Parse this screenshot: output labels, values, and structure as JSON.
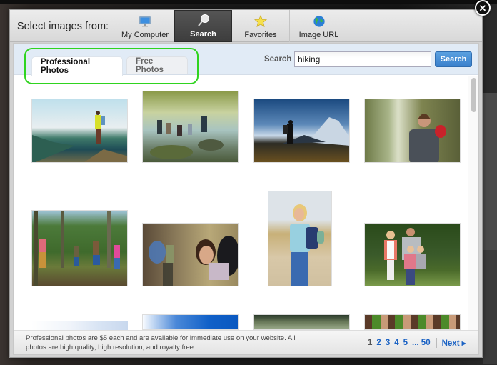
{
  "dialog": {
    "source_label": "Select images from:",
    "sources": [
      {
        "label": "My Computer",
        "icon": "monitor-icon",
        "active": false
      },
      {
        "label": "Search",
        "icon": "magnifier-icon",
        "active": true
      },
      {
        "label": "Favorites",
        "icon": "star-icon",
        "active": false
      },
      {
        "label": "Image URL",
        "icon": "globe-icon",
        "active": false
      }
    ],
    "close_icon": "close-icon"
  },
  "tabs": {
    "professional": "Professional Photos",
    "free": "Free Photos",
    "active": "Professional Photos"
  },
  "search": {
    "label": "Search",
    "value": "hiking",
    "button": "Search"
  },
  "results": [
    {
      "desc": "Hiker in yellow jacket on mountain overlook"
    },
    {
      "desc": "Group of hikers by forest river"
    },
    {
      "desc": "Silhouetted hiker against mountains"
    },
    {
      "desc": "Bearded man with red backpack in forest"
    },
    {
      "desc": "Kids walking in woods"
    },
    {
      "desc": "Smiling woman with backpack on trail"
    },
    {
      "desc": "Woman shading eyes on dirt path"
    },
    {
      "desc": "Family hiking on grassy trail"
    },
    {
      "desc": "Snowy mountain scene (partial)"
    },
    {
      "desc": "Hiker under blue sky (partial)"
    },
    {
      "desc": "Hikers in tall grass (partial)"
    },
    {
      "desc": "Legs of hikers on green trail (partial)"
    }
  ],
  "footer": {
    "note": "Professional photos are $5 each and are available for immediate use on your website. All photos are high quality, high resolution, and royalty free.",
    "pages": [
      "1",
      "2",
      "3",
      "4",
      "5",
      "... 50"
    ],
    "current_page": "1",
    "next": "Next ▸"
  },
  "colors": {
    "highlight": "#2fd41f",
    "link": "#1a62c4",
    "search_button": "#3a80cc"
  }
}
